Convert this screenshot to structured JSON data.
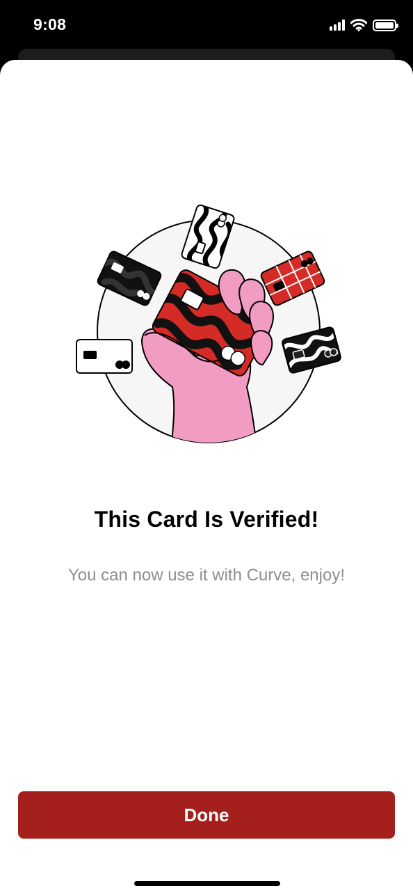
{
  "status_bar": {
    "time": "9:08",
    "icons": [
      "signal-icon",
      "wifi-icon",
      "battery-icon"
    ]
  },
  "illustration": {
    "icon": "hand-holding-cards-illustration",
    "colors": {
      "accent_red": "#d52b26",
      "hand_pink": "#f29cc3",
      "circle_fill": "#f6f6f6",
      "outline": "#000000"
    }
  },
  "content": {
    "title": "This Card Is Verified!",
    "subtitle": "You can now use it with Curve, enjoy!"
  },
  "actions": {
    "done_label": "Done",
    "button_color": "#a5201d"
  }
}
